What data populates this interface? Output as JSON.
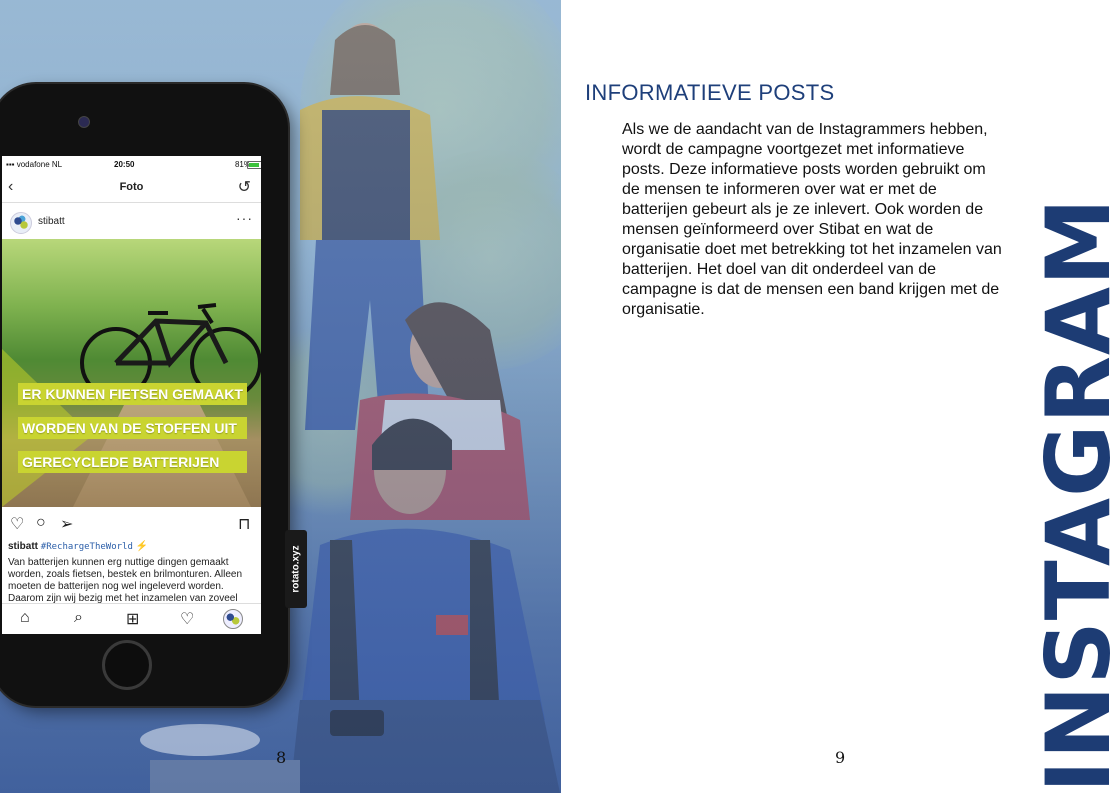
{
  "left_page": {
    "page_number": "8",
    "phone": {
      "status_bar": {
        "carrier": "vodafone NL",
        "time": "20:50",
        "battery": "81%"
      },
      "nav_title": "Foto",
      "post_username": "stibatt",
      "post_image_caption": [
        "ER KUNNEN FIETSEN GEMAAKT",
        "WORDEN VAN DE STOFFEN UIT",
        "GERECYCLEDE BATTERIJEN"
      ],
      "post_text": {
        "username": "stibatt",
        "hashtag": "#RechargeTheWorld",
        "emoji": "⚡",
        "body": "Van batterijen kunnen erg nuttige dingen gemaakt worden, zoals fietsen, bestek en brilmonturen. Alleen moeten de batterijen nog wel ingeleverd worden. Daarom zijn wij bezig met het inzamelen van zoveel"
      },
      "side_label": "rotato.xyz"
    }
  },
  "right_page": {
    "page_number": "9",
    "section_title": "INFORMATIEVE POSTS",
    "body": "Als we de aandacht van de Instagrammers hebben, wordt de campagne voortgezet met informatieve posts. Deze informatieve posts worden gebruikt om de mensen te informeren over wat er met de batterijen gebeurt als je ze inlevert. Ook worden de mensen geïnformeerd over Stibat en wat de organisatie doet met betrekking tot het inzamelen van batterijen. Het doel van dit onderdeel van de campagne is dat de mensen een band krijgen met de organisatie.",
    "vertical_heading": "INSTAGRAM"
  },
  "colors": {
    "heading_blue": "#1e3f7a",
    "caption_yellow": "#c9d431"
  },
  "icons": [
    "back-icon",
    "refresh-icon",
    "more-icon",
    "heart-icon",
    "comment-icon",
    "share-icon",
    "bookmark-icon",
    "home-icon",
    "search-icon",
    "add-icon",
    "activity-icon"
  ]
}
